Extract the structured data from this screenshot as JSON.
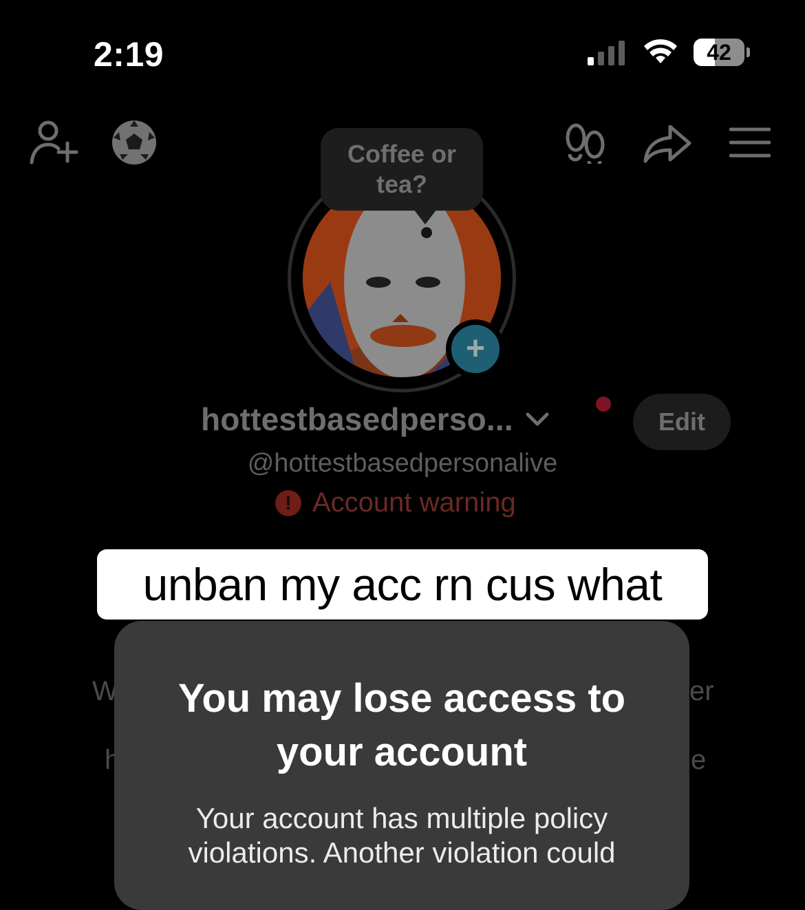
{
  "status_bar": {
    "time": "2:19",
    "battery_level": "42",
    "icons": [
      "cellular-signal-icon",
      "wifi-icon",
      "battery-icon"
    ]
  },
  "header": {
    "icons": [
      "add-friend-icon",
      "soccer-ball-icon",
      "footprints-icon",
      "share-icon",
      "menu-icon"
    ]
  },
  "profile": {
    "note_bubble": "Coffee or tea?",
    "display_name": "hottestbasedperso...",
    "handle": "@hottestbasedpersonalive",
    "edit_label": "Edit",
    "warning_label": "Account warning",
    "warning_icon_glyph": "!"
  },
  "background_fragments": {
    "left_1": "W",
    "left_2": "h",
    "right_1": "er",
    "right_2": "e"
  },
  "caption": "unban my acc rn cus what",
  "modal": {
    "title_line1": "You may lose access to",
    "title_line2": "your account",
    "body_line1": "Your account has multiple policy",
    "body_line2": "violations. Another violation could"
  },
  "colors": {
    "background": "#000000",
    "modal_background": "#3a3a3a",
    "warning": "#6a2a24",
    "plus_badge": "#1e5f73"
  }
}
